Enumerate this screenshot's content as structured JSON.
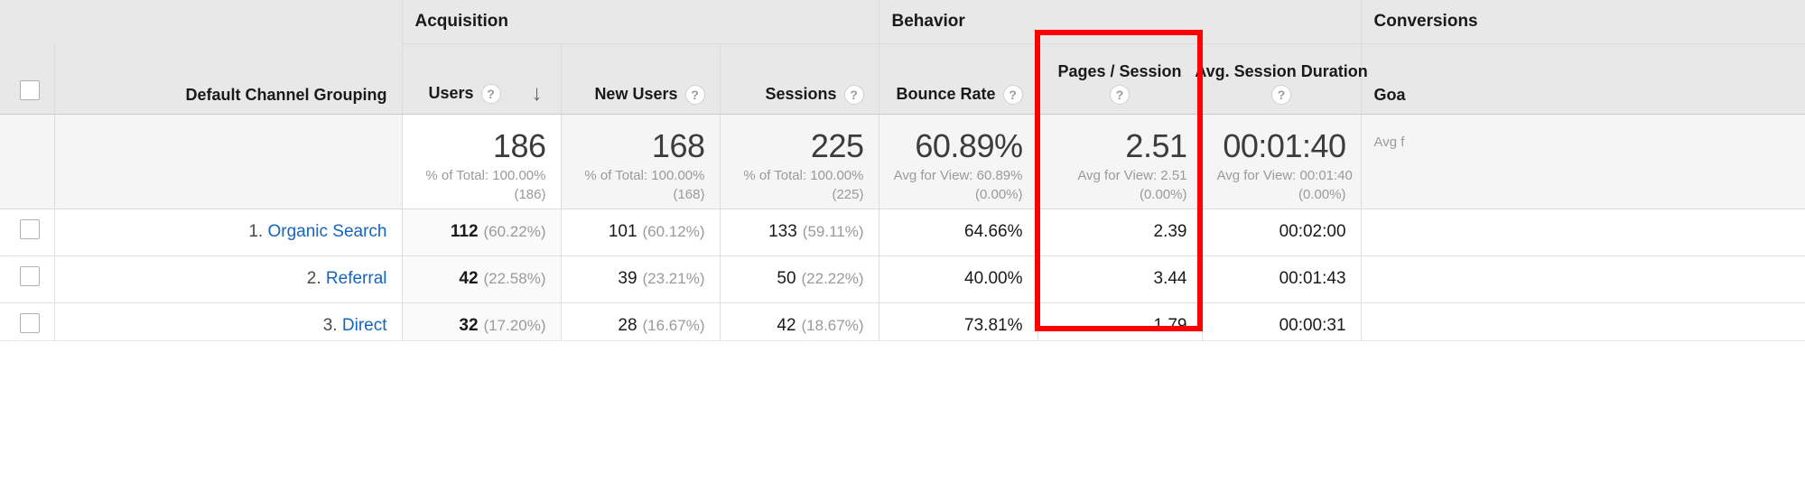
{
  "table": {
    "group_headers": [
      {
        "label": "",
        "key": "dimension"
      },
      {
        "label": "Acquisition",
        "key": "acquisition"
      },
      {
        "label": "Behavior",
        "key": "behavior"
      },
      {
        "label": "Conversions",
        "key": "conversions"
      }
    ],
    "dimension_header": "Default Channel Grouping",
    "columns": [
      {
        "label": "Users",
        "help": "?",
        "sorted": true,
        "sort_arrow": "↓"
      },
      {
        "label": "New Users",
        "help": "?",
        "sorted": false
      },
      {
        "label": "Sessions",
        "help": "?",
        "sorted": false
      },
      {
        "label": "Bounce Rate",
        "help": "?",
        "sorted": false
      },
      {
        "label": "Pages / Session",
        "help": "?",
        "sorted": false,
        "highlighted": true
      },
      {
        "label": "Avg. Session Duration",
        "help": "?",
        "sorted": false
      },
      {
        "label": "Goa",
        "help": "?",
        "sorted": false
      }
    ],
    "summary": {
      "users": {
        "value": "186",
        "sub1": "% of Total: 100.00%",
        "sub2": "(186)"
      },
      "new_users": {
        "value": "168",
        "sub1": "% of Total: 100.00%",
        "sub2": "(168)"
      },
      "sessions": {
        "value": "225",
        "sub1": "% of Total: 100.00%",
        "sub2": "(225)"
      },
      "bounce_rate": {
        "value": "60.89%",
        "sub1": "Avg for View: 60.89%",
        "sub2": "(0.00%)"
      },
      "pages_session": {
        "value": "2.51",
        "sub1": "Avg for View: 2.51",
        "sub2": "(0.00%)"
      },
      "avg_session_duration": {
        "value": "00:01:40",
        "sub1": "Avg for View: 00:01:40",
        "sub2": "(0.00%)"
      },
      "goal_conv": {
        "value": "",
        "sub1": "Avg f",
        "sub2": ""
      }
    },
    "rows": [
      {
        "rank": "1.",
        "channel": "Organic Search",
        "users": "112",
        "users_pct": "(60.22%)",
        "new_users": "101",
        "new_users_pct": "(60.12%)",
        "sessions": "133",
        "sessions_pct": "(59.11%)",
        "bounce_rate": "64.66%",
        "pages_session": "2.39",
        "avg_session_duration": "00:02:00",
        "goal_conv": ""
      },
      {
        "rank": "2.",
        "channel": "Referral",
        "users": "42",
        "users_pct": "(22.58%)",
        "new_users": "39",
        "new_users_pct": "(23.21%)",
        "sessions": "50",
        "sessions_pct": "(22.22%)",
        "bounce_rate": "40.00%",
        "pages_session": "3.44",
        "avg_session_duration": "00:01:43",
        "goal_conv": ""
      },
      {
        "rank": "3.",
        "channel": "Direct",
        "users": "32",
        "users_pct": "(17.20%)",
        "new_users": "28",
        "new_users_pct": "(16.67%)",
        "sessions": "42",
        "sessions_pct": "(18.67%)",
        "bounce_rate": "73.81%",
        "pages_session": "1.79",
        "avg_session_duration": "00:00:31",
        "goal_conv": ""
      }
    ],
    "highlight": {
      "color": "#ff0000",
      "target_column": "Pages / Session"
    }
  }
}
